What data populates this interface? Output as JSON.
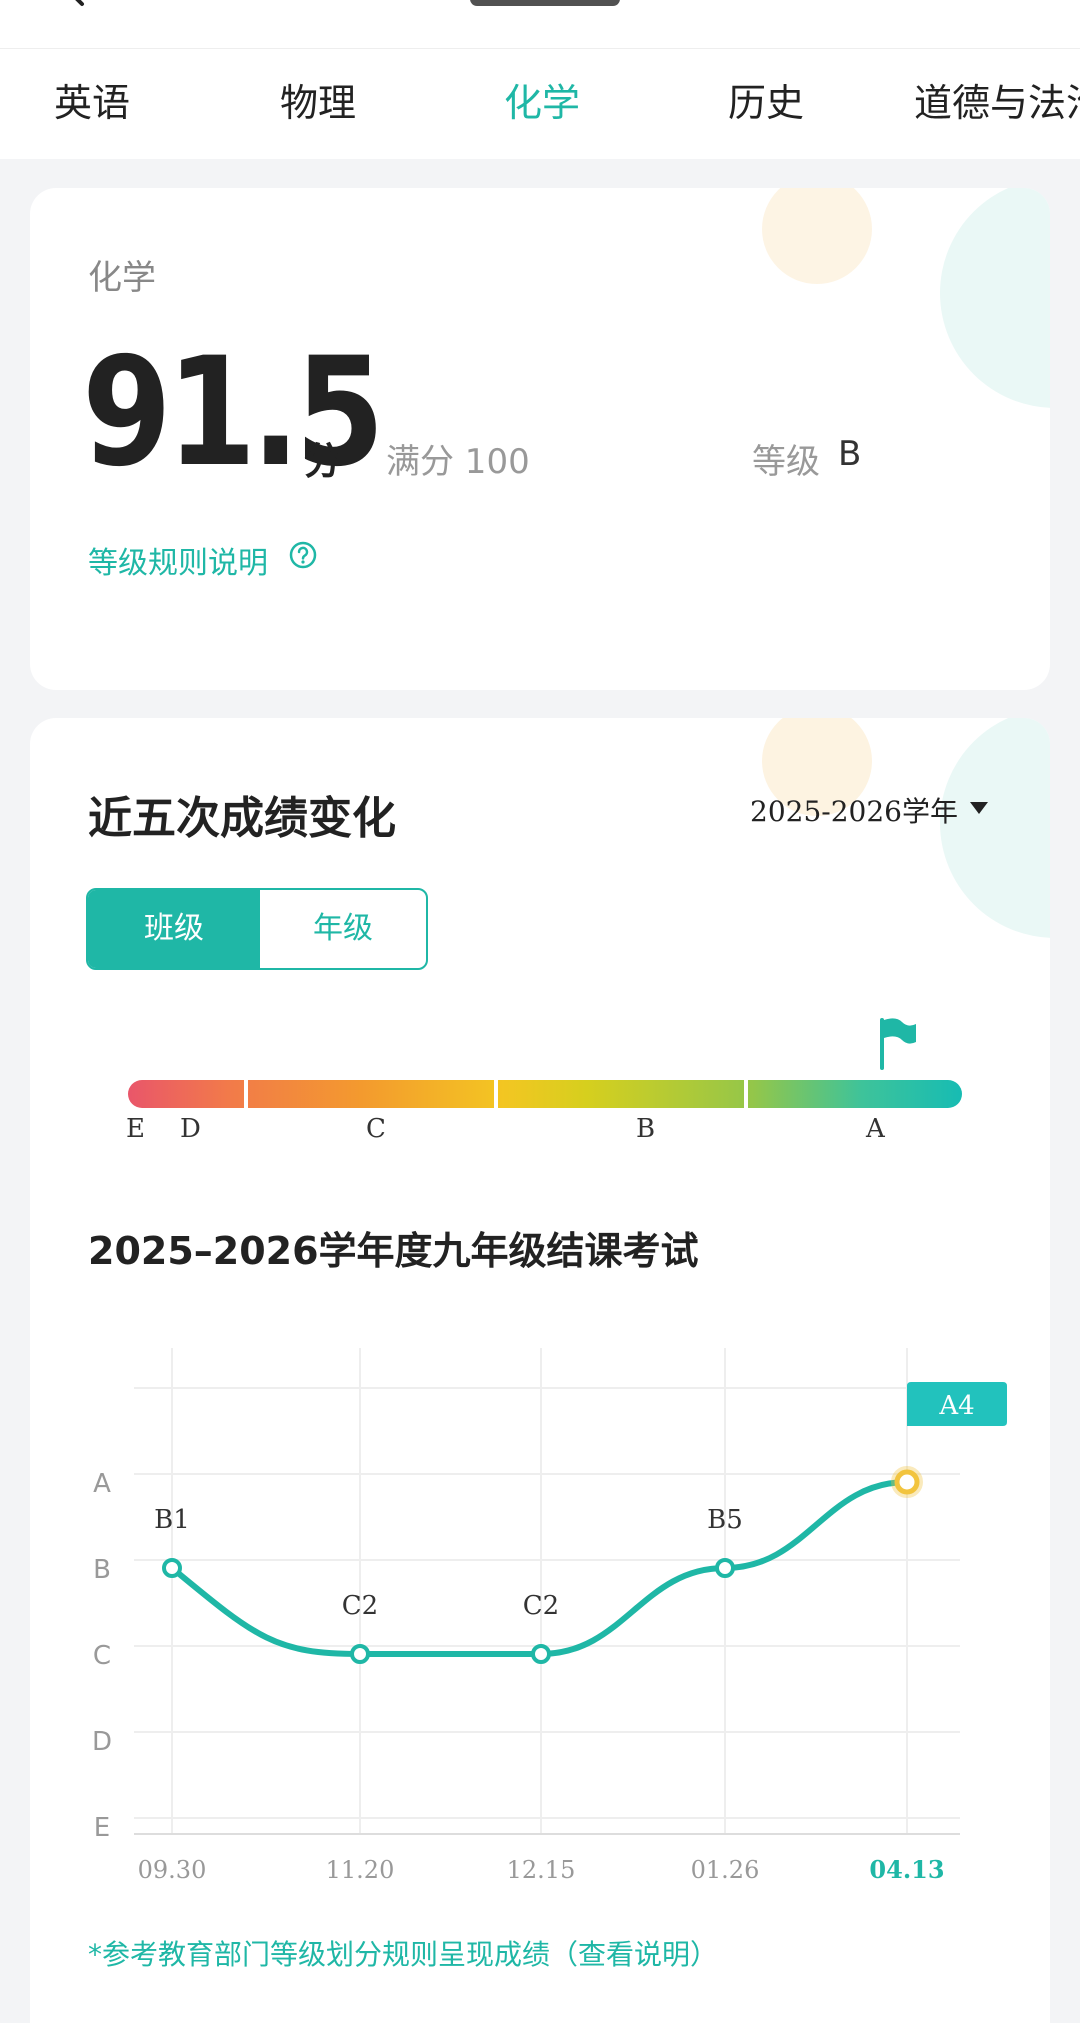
{
  "tabs": [
    "英语",
    "物理",
    "化学",
    "历史",
    "道德与法治"
  ],
  "active_tab": "化学",
  "colors": {
    "accent": "#1fb7a6",
    "highlight": "#f2c43e"
  },
  "score_card": {
    "subject": "化学",
    "score": "91.5",
    "unit": "分",
    "full_label": "满分 100",
    "level_label": "等级",
    "level_value": "B",
    "rule_link": "等级规则说明"
  },
  "trend": {
    "title": "近五次成绩变化",
    "year_select": "2025-2026学年",
    "toggle": [
      "班级",
      "年级"
    ],
    "selected_toggle": "班级",
    "grade_scale": [
      "E",
      "D",
      "C",
      "B",
      "A"
    ],
    "exam_title": "2025–2026学年度九年级结课考试",
    "footnote": "*参考教育部门等级划分规则呈现成绩（查看说明）"
  },
  "chart_data": {
    "type": "line",
    "x": [
      "09.30",
      "11.20",
      "12.15",
      "01.26",
      "04.13"
    ],
    "y_categories": [
      "E",
      "D",
      "C",
      "B",
      "A"
    ],
    "y_values": [
      3.5,
      2.5,
      2.5,
      3.5,
      4.5
    ],
    "point_labels": [
      "B1",
      "C2",
      "C2",
      "B5",
      "A4"
    ],
    "highlight_index": 4,
    "grid": true
  }
}
